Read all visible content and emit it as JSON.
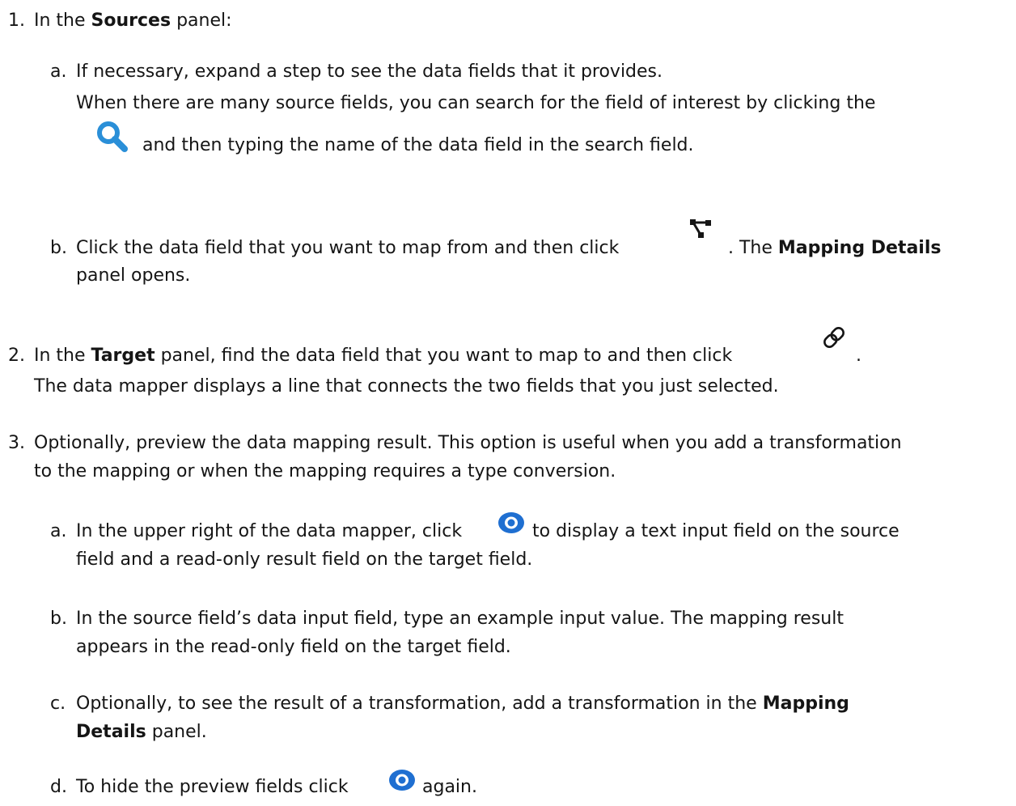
{
  "steps": [
    {
      "number": "1.",
      "text": {
        "pre": "In the",
        "bold": "Sources",
        "post": "panel:"
      },
      "substeps": [
        {
          "letter": "a.",
          "line1": "If necessary, expand a step to see the data fields that it provides.",
          "line2": "When there are many source fields, you can search for the field of interest by clicking the",
          "line3": "and then typing the name of the data field in the search field.",
          "icon": "search-icon"
        },
        {
          "letter": "b.",
          "pre": "Click the data field that you want to map from and then click",
          "mid": ". The",
          "bold": "Mapping Details",
          "line2": "panel opens.",
          "icon": "create-mapping-icon"
        }
      ]
    },
    {
      "number": "2.",
      "pre": "In the",
      "bold": "Target",
      "post": "panel, find the data field that you want to map to and then click",
      "end": ".",
      "line2": "The data mapper displays a line that connects the two fields that you just selected.",
      "icon": "link-icon"
    },
    {
      "number": "3.",
      "line1": "Optionally, preview the data mapping result. This option is useful when you add a transformation",
      "line2": "to the mapping or when the mapping requires a type conversion.",
      "substeps": [
        {
          "letter": "a.",
          "pre": "In the upper right of the data mapper, click",
          "post": "to display a text input field on the source",
          "line2": "field and a read-only result field on the target field.",
          "icon": "eye-icon"
        },
        {
          "letter": "b.",
          "line1": "In the source field’s data input field, type an example input value. The mapping result",
          "line2": "appears in the read-only field on the target field."
        },
        {
          "letter": "c.",
          "pre": "Optionally, to see the result of a transformation, add a transformation in the",
          "bold1": "Mapping",
          "bold2": "Details",
          "post": "panel."
        },
        {
          "letter": "d.",
          "pre": "To hide the preview fields click",
          "post": "again.",
          "icon": "eye-icon"
        }
      ]
    }
  ],
  "colors": {
    "text": "#151515",
    "accent": "#2a8fd8",
    "icon_blue": "#1f6fd1"
  }
}
